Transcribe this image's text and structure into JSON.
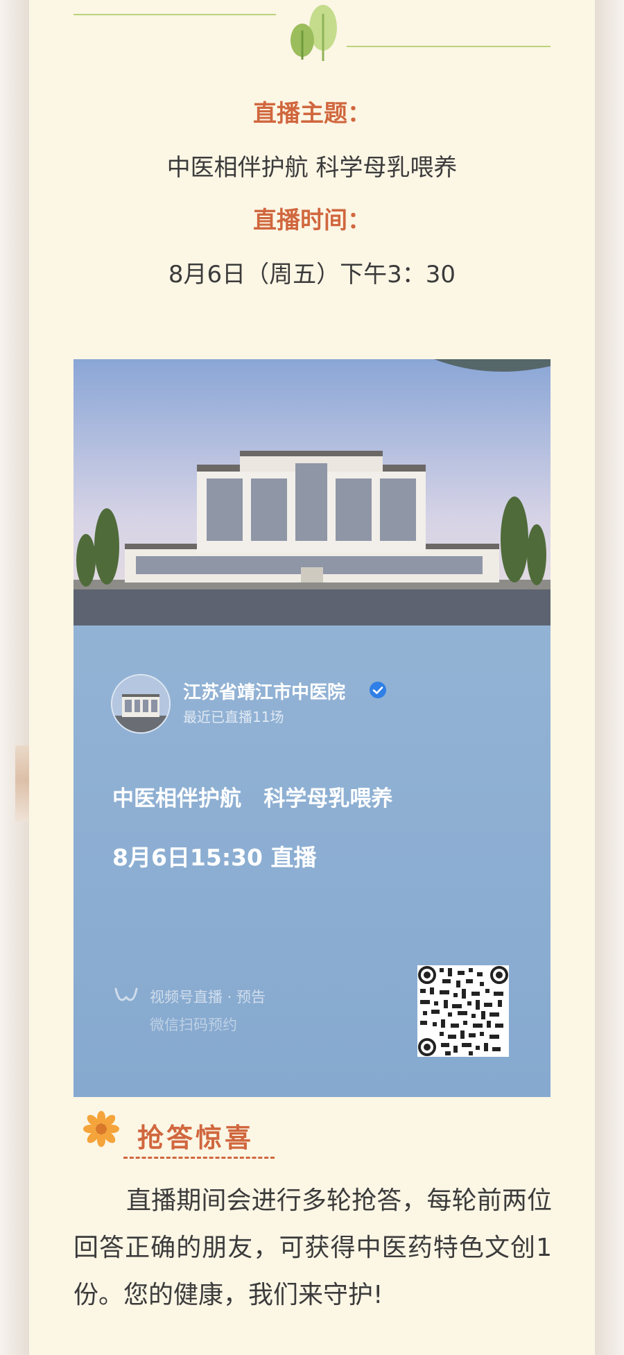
{
  "header": {
    "topic_label": "直播主题：",
    "topic": "中医相伴护航  科学母乳喂养",
    "time_label": "直播时间：",
    "time": "8月6日（周五）下午3：30"
  },
  "live_card": {
    "org_name": "江苏省靖江市中医院",
    "org_sub": "最近已直播11场",
    "title": "中医相伴护航   科学母乳喂养",
    "time": "8月6日15:30 直播",
    "channel": "视频号直播 · 预告",
    "scan": "微信扫码预约"
  },
  "surprise": {
    "title": "抢答惊喜",
    "text": "直播期间会进行多轮抢答，每轮前两位回答正确的朋友，可获得中医药特色文创1份。您的健康，我们来守护!"
  },
  "colors": {
    "accent": "#d0673e",
    "card_bg": "#fcf6e5",
    "line_green": "#b9d37a",
    "live_blue": "#8fb0d3"
  },
  "icons": [
    "tree-icon",
    "verified-icon",
    "channels-icon",
    "qr-code",
    "flower-icon"
  ]
}
